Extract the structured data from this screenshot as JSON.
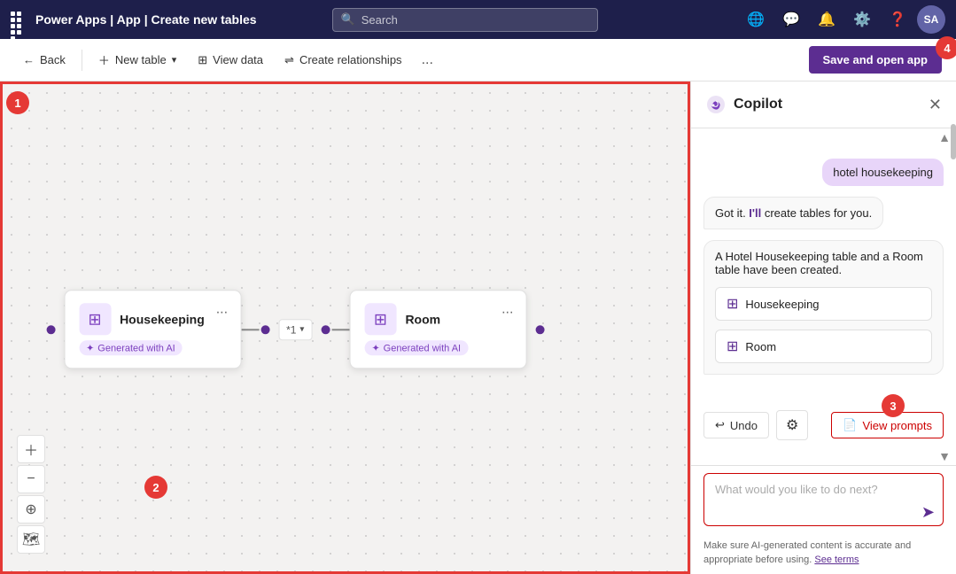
{
  "topbar": {
    "app_name": "Power Apps",
    "separator1": "|",
    "breadcrumb1": "App",
    "separator2": "|",
    "breadcrumb2": "Create new tables",
    "search_placeholder": "Search",
    "icons": [
      "globe",
      "chat",
      "bell",
      "gear",
      "help"
    ],
    "avatar_initials": "SA"
  },
  "toolbar": {
    "back_label": "Back",
    "new_table_label": "New table",
    "view_data_label": "View data",
    "create_relationships_label": "Create relationships",
    "more_label": "...",
    "save_label": "Save and open app"
  },
  "canvas": {
    "card1": {
      "title": "Housekeeping",
      "badge": "Generated with AI",
      "menu": "..."
    },
    "card2": {
      "title": "Room",
      "badge": "Generated with AI",
      "menu": "..."
    },
    "connector": "*1"
  },
  "copilot": {
    "title": "Copilot",
    "close_label": "✕",
    "user_msg": "hotel housekeeping",
    "bot_msg1": "Got it. I'll create tables for you.",
    "bot_msg2": "A Hotel Housekeeping table and a Room table have been created.",
    "table1_chip": "Housekeeping",
    "table2_chip": "Room",
    "undo_label": "Undo",
    "view_prompts_label": "View prompts",
    "input_placeholder": "What would you like to do next?",
    "disclaimer": "Make sure AI-generated content is accurate and appropriate before using.",
    "see_terms_label": "See terms"
  },
  "steps": {
    "s1": "1",
    "s2": "2",
    "s3": "3",
    "s4": "4"
  }
}
